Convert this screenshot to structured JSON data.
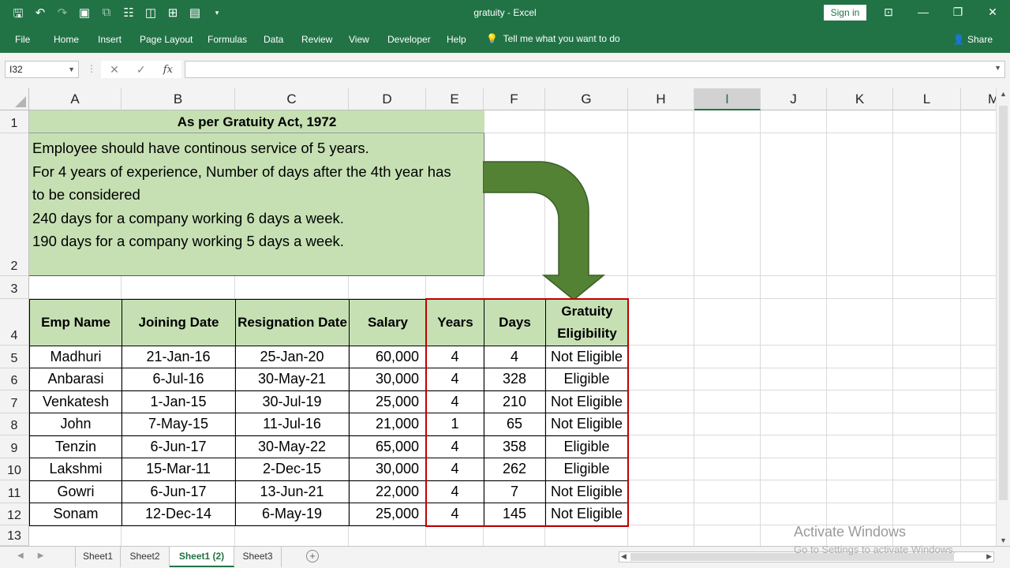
{
  "app": {
    "doc_title": "gratuity  -  Excel",
    "signin": "Sign in",
    "share": "Share",
    "tell_me": "Tell me what you want to do"
  },
  "ribbon_tabs": [
    "File",
    "Home",
    "Insert",
    "Page Layout",
    "Formulas",
    "Data",
    "Review",
    "View",
    "Developer",
    "Help"
  ],
  "formula_bar": {
    "name_box": "I32",
    "fx": "fx",
    "formula": ""
  },
  "columns": [
    "A",
    "B",
    "C",
    "D",
    "E",
    "F",
    "G",
    "H",
    "I",
    "J",
    "K",
    "L",
    "M"
  ],
  "selected_column": "I",
  "rows": [
    "1",
    "2",
    "3",
    "4",
    "5",
    "6",
    "7",
    "8",
    "9",
    "10",
    "11",
    "12",
    "13"
  ],
  "sheet": {
    "title": "As per Gratuity Act, 1972",
    "notes": [
      "Employee should have continous service of 5 years.",
      "For 4 years of experience, Number of days after the 4th year has",
      "to be considered",
      "240 days for a company working 6 days a week.",
      "190 days for a company working 5 days a week."
    ],
    "headers": {
      "emp_name": "Emp Name",
      "joining": "Joining Date",
      "resignation": "Resignation Date",
      "salary": "Salary",
      "years": "Years",
      "days": "Days",
      "eligibility_1": "Gratuity",
      "eligibility_2": "Eligibility"
    },
    "data": [
      {
        "name": "Madhuri",
        "join": "21-Jan-16",
        "resign": "25-Jan-20",
        "salary": "60,000",
        "years": "4",
        "days": "4",
        "elig": "Not Eligible"
      },
      {
        "name": "Anbarasi",
        "join": "6-Jul-16",
        "resign": "30-May-21",
        "salary": "30,000",
        "years": "4",
        "days": "328",
        "elig": "Eligible"
      },
      {
        "name": "Venkatesh",
        "join": "1-Jan-15",
        "resign": "30-Jul-19",
        "salary": "25,000",
        "years": "4",
        "days": "210",
        "elig": "Not Eligible"
      },
      {
        "name": "John",
        "join": "7-May-15",
        "resign": "11-Jul-16",
        "salary": "21,000",
        "years": "1",
        "days": "65",
        "elig": "Not Eligible"
      },
      {
        "name": "Tenzin",
        "join": "6-Jun-17",
        "resign": "30-May-22",
        "salary": "65,000",
        "years": "4",
        "days": "358",
        "elig": "Eligible"
      },
      {
        "name": "Lakshmi",
        "join": "15-Mar-11",
        "resign": "2-Dec-15",
        "salary": "30,000",
        "years": "4",
        "days": "262",
        "elig": "Eligible"
      },
      {
        "name": "Gowri",
        "join": "6-Jun-17",
        "resign": "13-Jun-21",
        "salary": "22,000",
        "years": "4",
        "days": "7",
        "elig": "Not Eligible"
      },
      {
        "name": "Sonam",
        "join": "12-Dec-14",
        "resign": "6-May-19",
        "salary": "25,000",
        "years": "4",
        "days": "145",
        "elig": "Not Eligible"
      }
    ]
  },
  "sheet_tabs": [
    "Sheet1",
    "Sheet2",
    "Sheet1 (2)",
    "Sheet3"
  ],
  "active_sheet": "Sheet1 (2)",
  "watermark": {
    "line1": "Activate Windows",
    "line2": "Go to Settings to activate Windows."
  },
  "colors": {
    "excel_green": "#217346",
    "cell_fill": "#c6e0b4",
    "arrow_fill": "#548235",
    "highlight_border": "#c00000"
  }
}
